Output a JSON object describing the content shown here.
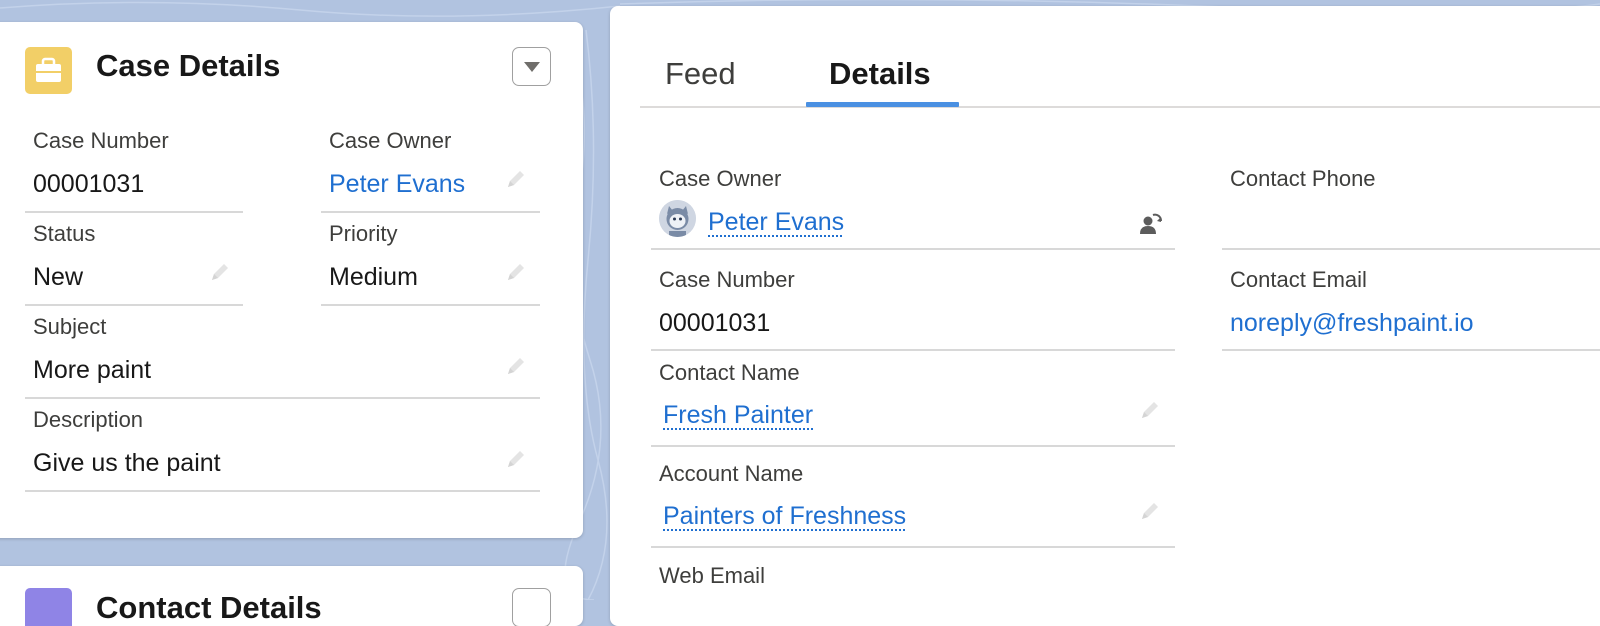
{
  "colors": {
    "background": "#b1c3e0",
    "card_icon": "#f2cf67",
    "contact_icon": "#8f84e6",
    "link": "#1f6fd0",
    "tab_active_underline": "#4a90e2"
  },
  "left_card": {
    "title": "Case Details",
    "icon": "briefcase-icon",
    "fields": {
      "case_number": {
        "label": "Case Number",
        "value": "00001031"
      },
      "case_owner": {
        "label": "Case Owner",
        "value": "Peter Evans"
      },
      "status": {
        "label": "Status",
        "value": "New"
      },
      "priority": {
        "label": "Priority",
        "value": "Medium"
      },
      "subject": {
        "label": "Subject",
        "value": "More paint"
      },
      "description": {
        "label": "Description",
        "value": "Give us the paint"
      }
    }
  },
  "second_card": {
    "title": "Contact Details",
    "icon": "contact-icon"
  },
  "tabs": [
    {
      "label": "Feed",
      "active": false
    },
    {
      "label": "Details",
      "active": true
    }
  ],
  "details": {
    "case_owner": {
      "label": "Case Owner",
      "value": "Peter Evans"
    },
    "case_number": {
      "label": "Case Number",
      "value": "00001031"
    },
    "contact_name": {
      "label": "Contact Name",
      "value": "Fresh Painter"
    },
    "account_name": {
      "label": "Account Name",
      "value": "Painters of Freshness"
    },
    "web_email": {
      "label": "Web Email",
      "value": ""
    },
    "contact_phone": {
      "label": "Contact Phone",
      "value": ""
    },
    "contact_email": {
      "label": "Contact Email",
      "value": "noreply@freshpaint.io"
    }
  }
}
